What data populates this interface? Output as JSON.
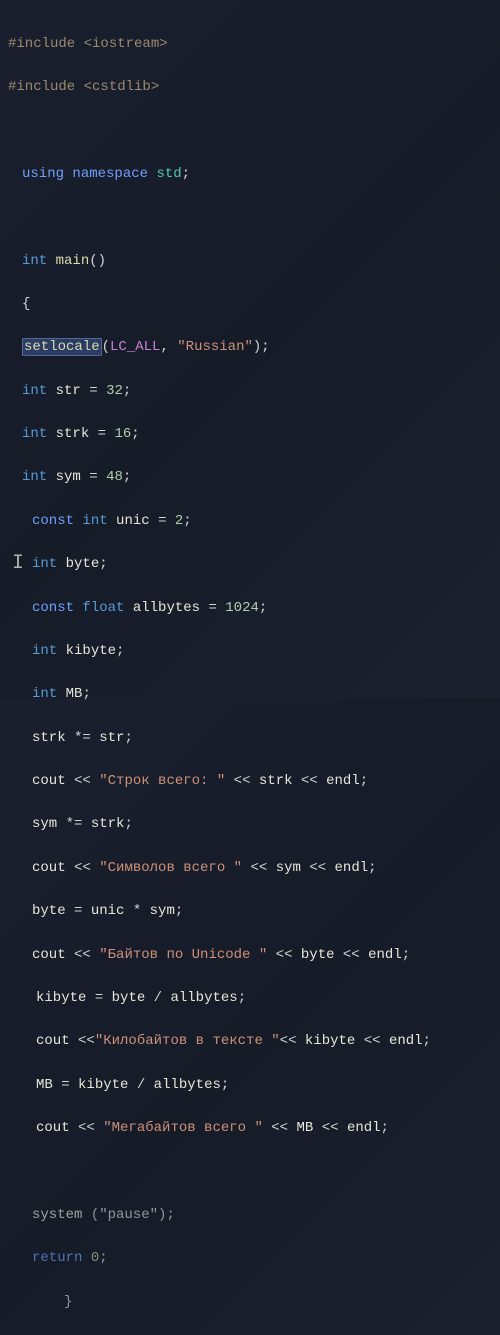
{
  "code": {
    "include1_directive": "#include",
    "include1_header": "<iostream>",
    "include2_directive": "#include",
    "include2_header": "<cstdlib>",
    "using": "using",
    "namespace": "namespace",
    "std": "std",
    "semi": ";",
    "int": "int",
    "main": "main",
    "parens": "()",
    "lbrace": "{",
    "setlocale": "setlocale",
    "lc_all": "LC_ALL",
    "comma": ",",
    "russian": "\"Russian\"",
    "decl_str": "str",
    "val_str": "32",
    "decl_strk": "strk",
    "val_strk": "16",
    "decl_sym": "sym",
    "val_sym": "48",
    "const": "const",
    "decl_unic": "unic",
    "val_unic": "2",
    "decl_byte": "byte",
    "float": "float",
    "decl_allbytes": "allbytes",
    "val_allbytes": "1024",
    "decl_kibyte": "kibyte",
    "decl_mb": "MB",
    "op_muleq": "*=",
    "op_eq": "=",
    "op_mul": "*",
    "op_div": "/",
    "cout": "cout",
    "ins": "<<",
    "endl": "endl",
    "str1": "\"Строк всего: \"",
    "str2": "\"Символов всего \"",
    "str3": "\"Байтов по Unicode \"",
    "str4": "\"Килобайтов в тексте \"",
    "str5": "\"Мегабайтов всего \"",
    "system": "system",
    "pause": "(\"pause\")",
    "return": "return",
    "zero": "0",
    "rbrace": "}",
    "cursor": "I"
  }
}
